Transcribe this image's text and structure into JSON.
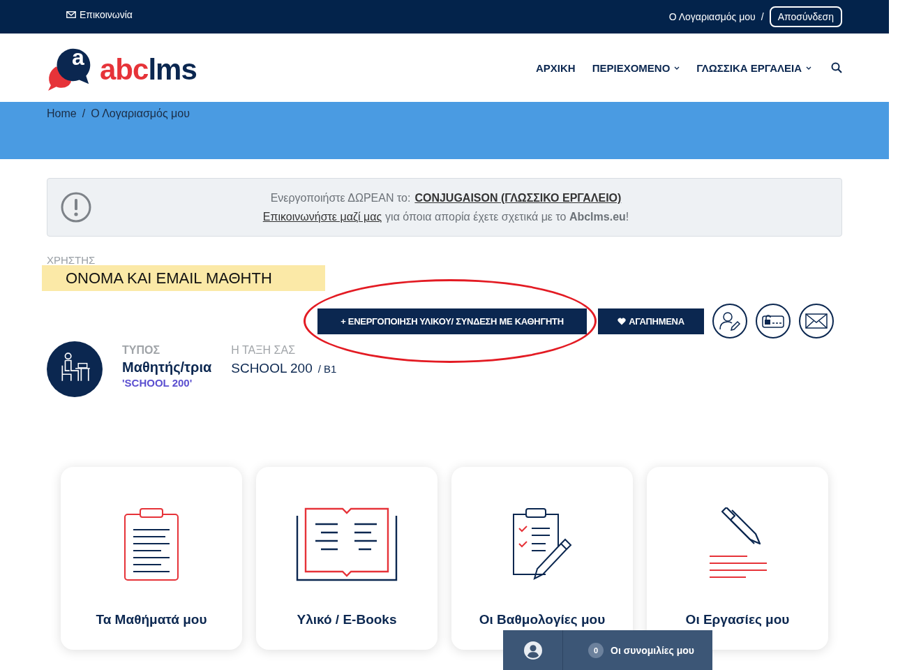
{
  "top_bar": {
    "contact": "Επικοινωνία",
    "account": "Ο Λογαριασμός μου",
    "separator": "/",
    "logout": "Αποσύνδεση"
  },
  "logo": {
    "mark": "a",
    "text_1": "abc",
    "text_2": "lms"
  },
  "nav": [
    {
      "label": "ΑΡΧΙΚΗ",
      "has_dropdown": false
    },
    {
      "label": "ΠΕΡΙΕΧΟΜΕΝΟ",
      "has_dropdown": true
    },
    {
      "label": "ΓΛΩΣΣΙΚΑ ΕΡΓΑΛΕΙΑ",
      "has_dropdown": true
    }
  ],
  "breadcrumb": {
    "items": [
      "Home",
      "Ο Λογαριασμός μου"
    ],
    "separator": "/"
  },
  "alert": {
    "prefix": "Ενεργοποιήστε ΔΩΡΕΑΝ το:",
    "link": "CONJUGAISON (ΓΛΩΣΣΙΚΟ ΕΡΓΑΛΕΙΟ)",
    "contact_link": "Επικοινωνήστε μαζί μας",
    "text": "για όποια απορία έχετε σχετικά με το **Abclms.eu**!"
  },
  "user": {
    "label": "ΧΡΗΣΤΗΣ",
    "name": "ΟΝΟΜΑ ΚΑΙ EMAIL ΜΑΘΗΤΗ"
  },
  "actions": {
    "activate": "+ ΕΝΕΡΓΟΠΟΙΗΣΗ ΥΛΙΚΟΥ/ ΣΥΝΔΕΣΗ ΜΕ ΚΑΘΗΓΗΤΗ",
    "favorites": "ΑΓΑΠΗΜΕΝΑ",
    "icons": [
      {
        "kind": "edit-profile"
      },
      {
        "kind": "password"
      },
      {
        "kind": "mail"
      }
    ]
  },
  "profile": {
    "type_label": "ΤΥΠΟΣ",
    "type": "Μαθητής/τρια",
    "school": "'SCHOOL 200'",
    "class_label": "Η ΤΑΞΗ ΣΑΣ",
    "class": "SCHOOL 200",
    "level": "/ B1"
  },
  "cards": [
    {
      "kind": "lessons",
      "title": "Τα Μαθήματά μου"
    },
    {
      "kind": "ebooks",
      "title": "Υλικό / E-Books"
    },
    {
      "kind": "grades",
      "title": "Οι Βαθμολογίες μου"
    },
    {
      "kind": "assignments",
      "title": "Οι Εργασίες μου"
    }
  ],
  "chat": {
    "count": "0",
    "label": "Οι συνομιλίες μου"
  }
}
